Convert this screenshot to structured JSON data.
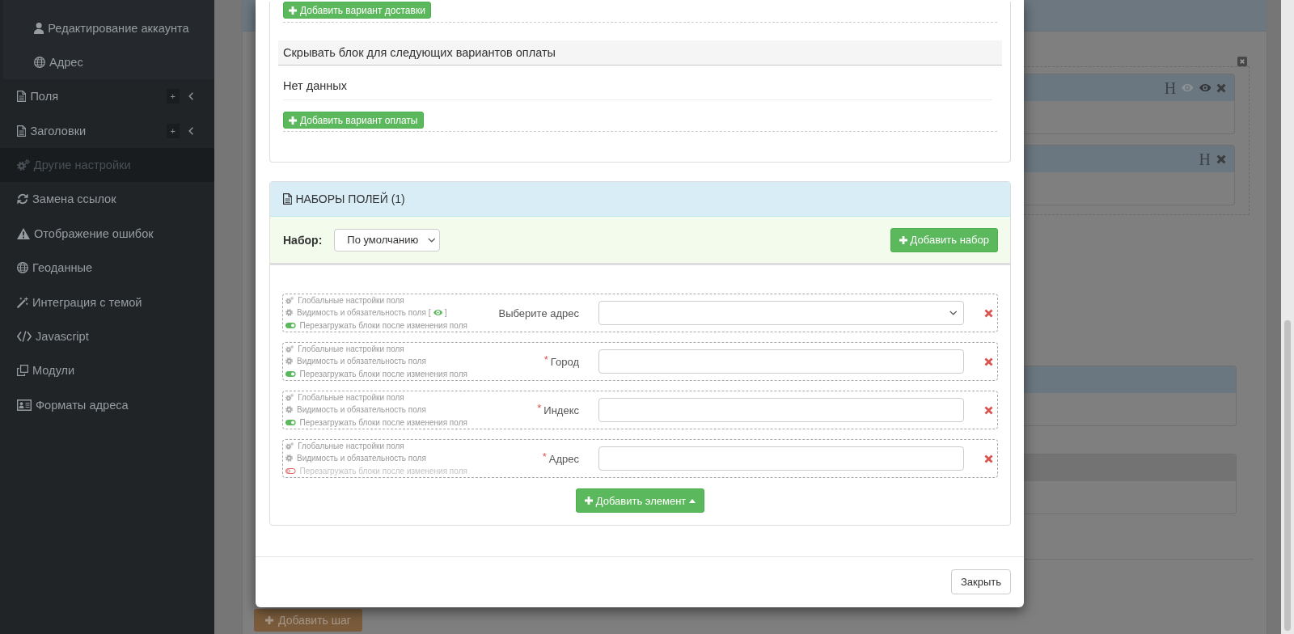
{
  "sidebar": {
    "submenu_items": [
      {
        "label": "Редактирование аккаунта",
        "selected": false
      },
      {
        "label": "Адрес",
        "selected": false
      }
    ],
    "items": [
      {
        "label": "Поля",
        "kind": "group",
        "badge": "+",
        "expanded": false,
        "selected": false
      },
      {
        "label": "Заголовки",
        "kind": "group",
        "badge": "+",
        "expanded": false,
        "selected": false
      },
      {
        "label": "Другие настройки",
        "kind": "link",
        "selected": true
      },
      {
        "label": "Замена ссылок",
        "kind": "link",
        "selected": false
      },
      {
        "label": "Отображение ошибок",
        "kind": "link",
        "selected": false
      },
      {
        "label": "Геоданные",
        "kind": "link",
        "selected": false
      },
      {
        "label": "Интеграция с темой",
        "kind": "link",
        "selected": false
      },
      {
        "label": "Javascript",
        "kind": "link",
        "selected": false
      },
      {
        "label": "Модули",
        "kind": "link",
        "selected": false
      },
      {
        "label": "Форматы адреса",
        "kind": "link",
        "selected": false
      }
    ]
  },
  "background": {
    "group": {
      "cards": [
        {
          "kind": "info",
          "mark": "H",
          "eyes": [
            {
              "on": false
            },
            {
              "on": true
            }
          ],
          "removable": true
        },
        {
          "kind": "info",
          "mark": "H",
          "removable": true
        }
      ]
    },
    "cards": [
      {
        "kind": "info"
      },
      {
        "kind": "default"
      }
    ],
    "add_step_button": "Добавить шаг"
  },
  "modal": {
    "delivery": {
      "add_button": "Добавить вариант доставки"
    },
    "payment": {
      "title": "Скрывать блок для следующих вариантов оплаты",
      "empty_text": "Нет данных",
      "add_button": "Добавить вариант оплаты"
    },
    "field_sets": {
      "title": "НАБОРЫ ПОЛЕЙ (1)",
      "set_label": "Набор:",
      "set_select": "По умолчанию",
      "add_set_button": "Добавить набор",
      "fields": [
        {
          "global_settings": "Глобальные настройки поля",
          "visibility": "Видимость и обязательность поля",
          "visibility_rule": {
            "open": "[",
            "close": "]"
          },
          "reload": "Перезагружать блоки после изменения поля",
          "reload_on": true,
          "label": "Выберите адрес",
          "kind": "select"
        },
        {
          "global_settings": "Глобальные настройки поля",
          "visibility": "Видимость и обязательность поля",
          "reload": "Перезагружать блоки после изменения поля",
          "reload_on": true,
          "required_mark": "*",
          "label": "Город",
          "kind": "text"
        },
        {
          "global_settings": "Глобальные настройки поля",
          "visibility": "Видимость и обязательность поля",
          "reload": "Перезагружать блоки после изменения поля",
          "reload_on": true,
          "required_mark": "*",
          "label": "Индекс",
          "kind": "text"
        },
        {
          "global_settings": "Глобальные настройки поля",
          "visibility": "Видимость и обязательность поля",
          "reload": "Перезагружать блоки после изменения поля",
          "reload_on": false,
          "required_mark": "*",
          "label": "Адрес",
          "kind": "text"
        }
      ],
      "add_element_button": "Добавить элемент"
    },
    "close_button": "Закрыть"
  }
}
